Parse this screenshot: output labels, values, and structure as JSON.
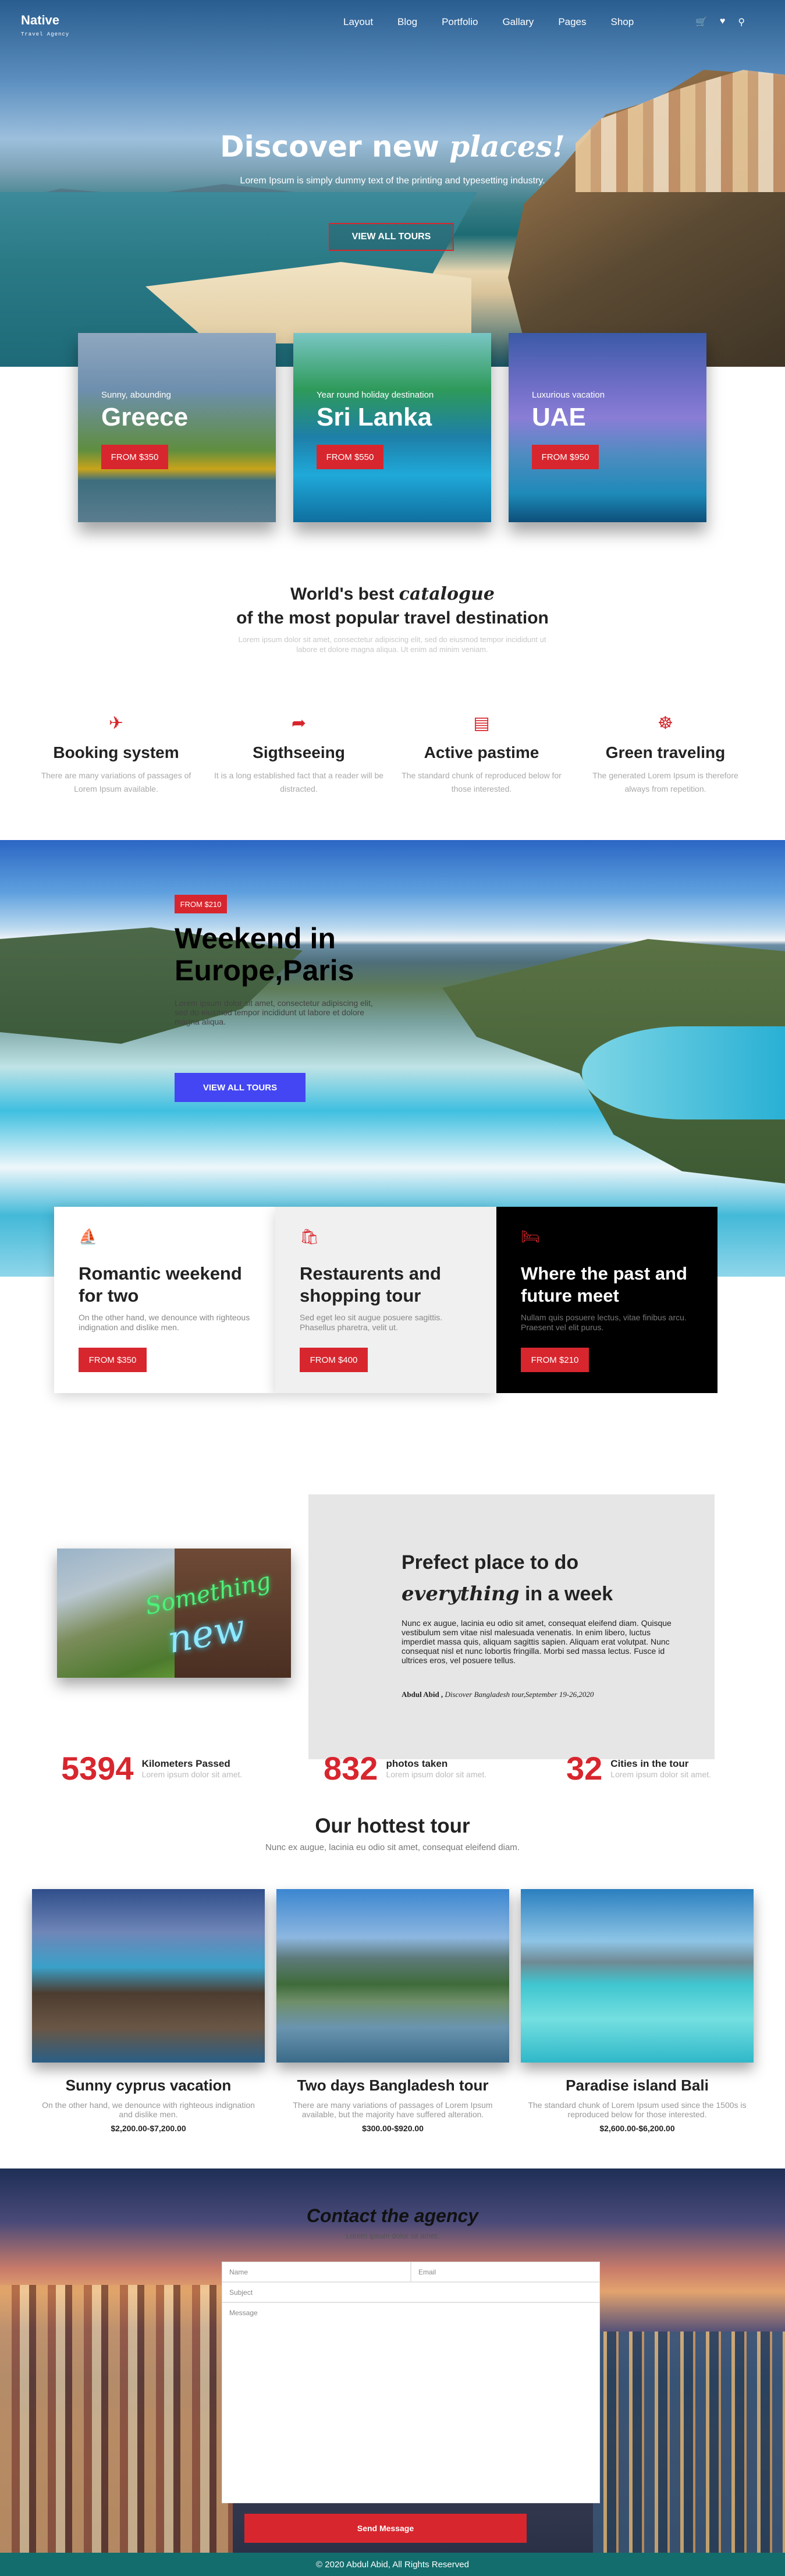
{
  "brand": {
    "name": "Native",
    "tagline": "Travel Agency"
  },
  "nav": {
    "items": [
      "Layout",
      "Blog",
      "Portfolio",
      "Gallary",
      "Pages",
      "Shop"
    ],
    "icons": [
      "cart-icon",
      "heart-icon",
      "search-icon"
    ]
  },
  "hero": {
    "title_plain": "Discover new",
    "title_script": "places!",
    "subtitle": "Lorem Ipsum is simply dummy text of the printing and typesetting industry.",
    "button": "VIEW ALL TOURS"
  },
  "destinations": [
    {
      "small": "Sunny, abounding",
      "name": "Greece",
      "price": "FROM $350"
    },
    {
      "small": "Year round holiday destination",
      "name": "Sri Lanka",
      "price": "FROM $550"
    },
    {
      "small": "Luxurious vacation",
      "name": "UAE",
      "price": "FROM $950"
    }
  ],
  "catalogue": {
    "line1_plain": "World's best",
    "line1_script": "catalogue",
    "line2": "of the most popular travel destination",
    "text": "Lorem ipsum dolor sit amet, consectetur adipiscing elit, sed do eiusmod tempor incididunt ut labore et dolore magna aliqua. Ut enim ad minim veniam."
  },
  "features": [
    {
      "icon": "airplane-icon",
      "title": "Booking system",
      "text": "There are many variations of passages of Lorem Ipsum available."
    },
    {
      "icon": "signpost-icon",
      "title": "Sigthseeing",
      "text": "It is a long established fact that a reader will be distracted."
    },
    {
      "icon": "cable-car-icon",
      "title": "Active pastime",
      "text": "The standard chunk of reproduced below for those interested."
    },
    {
      "icon": "ship-wheel-icon",
      "title": "Green traveling",
      "text": "The generated Lorem Ipsum is therefore always from repetition."
    }
  ],
  "paris": {
    "badge": "FROM $210",
    "title_line1": "Weekend in",
    "title_line2": "Europe,Paris",
    "text": "Lorem ipsum dolor sit amet, consectetur adipiscing elit, sed do eiusmod tempor incididunt ut labore et dolore magna aliqua.",
    "button": "VIEW ALL TOURS"
  },
  "boxes": [
    {
      "icon": "ship-icon",
      "title": "Romantic weekend for two",
      "text": "On the other hand, we denounce with righteous indignation and dislike men.",
      "price": "FROM $350"
    },
    {
      "icon": "shopping-bag-icon",
      "title": "Restaurents and shopping tour",
      "text": "Sed eget leo sit augue posuere sagittis. Phasellus pharetra, velit ut.",
      "price": "FROM $400"
    },
    {
      "icon": "bed-icon",
      "title": "Where the past and future meet",
      "text": "Nullam quis posuere lectus, vitae finibus arcu. Praesent vel elit purus.",
      "price": "FROM $210"
    }
  ],
  "perfect": {
    "h1": "Prefect place to do",
    "h2_script": "everything",
    "h2_plain": "in a week",
    "text": "Nunc ex augue, lacinia eu odio sit amet, consequat eleifend diam. Quisque vestibulum sem vitae nisl malesuada venenatis. In enim libero, luctus imperdiet massa quis, aliquam sagittis sapien. Aliquam erat volutpat. Nunc consequat nisl et nunc lobortis fringilla. Morbi sed massa lectus. Fusce id ultrices eros, vel posuere tellus.",
    "author": "Abdul Abid ,",
    "author_note": "Discover Bangladesh tour,September 19-26,2020",
    "image_word1": "Something",
    "image_word2": "new"
  },
  "stats": [
    {
      "number": "5394",
      "label": "Kilometers Passed",
      "sub": "Lorem ipsum dolor sit amet."
    },
    {
      "number": "832",
      "label": "photos taken",
      "sub": "Lorem ipsum dolor sit amet."
    },
    {
      "number": "32",
      "label": "Cities in the tour",
      "sub": "Lorem ipsum dolor sit amet."
    }
  ],
  "hottest": {
    "title": "Our hottest tour",
    "subtitle": "Nunc ex augue, lacinia eu odio sit amet, consequat eleifend diam.",
    "tours": [
      {
        "title": "Sunny cyprus vacation",
        "text": "On the other hand, we denounce with righteous indignation and dislike men.",
        "price": "$2,200.00-$7,200.00"
      },
      {
        "title": "Two days Bangladesh tour",
        "text": "There are many variations of passages of Lorem Ipsum available, but the majority have suffered alteration.",
        "price": "$300.00-$920.00"
      },
      {
        "title": "Paradise island Bali",
        "text": "The standard chunk of Lorem Ipsum used since the 1500s is reproduced below for those interested.",
        "price": "$2,600.00-$6,200.00"
      }
    ]
  },
  "contact": {
    "title": "Contact the agency",
    "subtitle": "Lorem ipsum dolor sit amet.",
    "name_ph": "Name",
    "email_ph": "Email",
    "subject_ph": "Subject",
    "message_ph": "Message",
    "send": "Send Message"
  },
  "footer": {
    "text": "© 2020 Abdul Abid, All Rights Reserved"
  },
  "colors": {
    "accent": "#d8262e",
    "blue_button": "#4346f2",
    "footer": "#146d6d"
  }
}
